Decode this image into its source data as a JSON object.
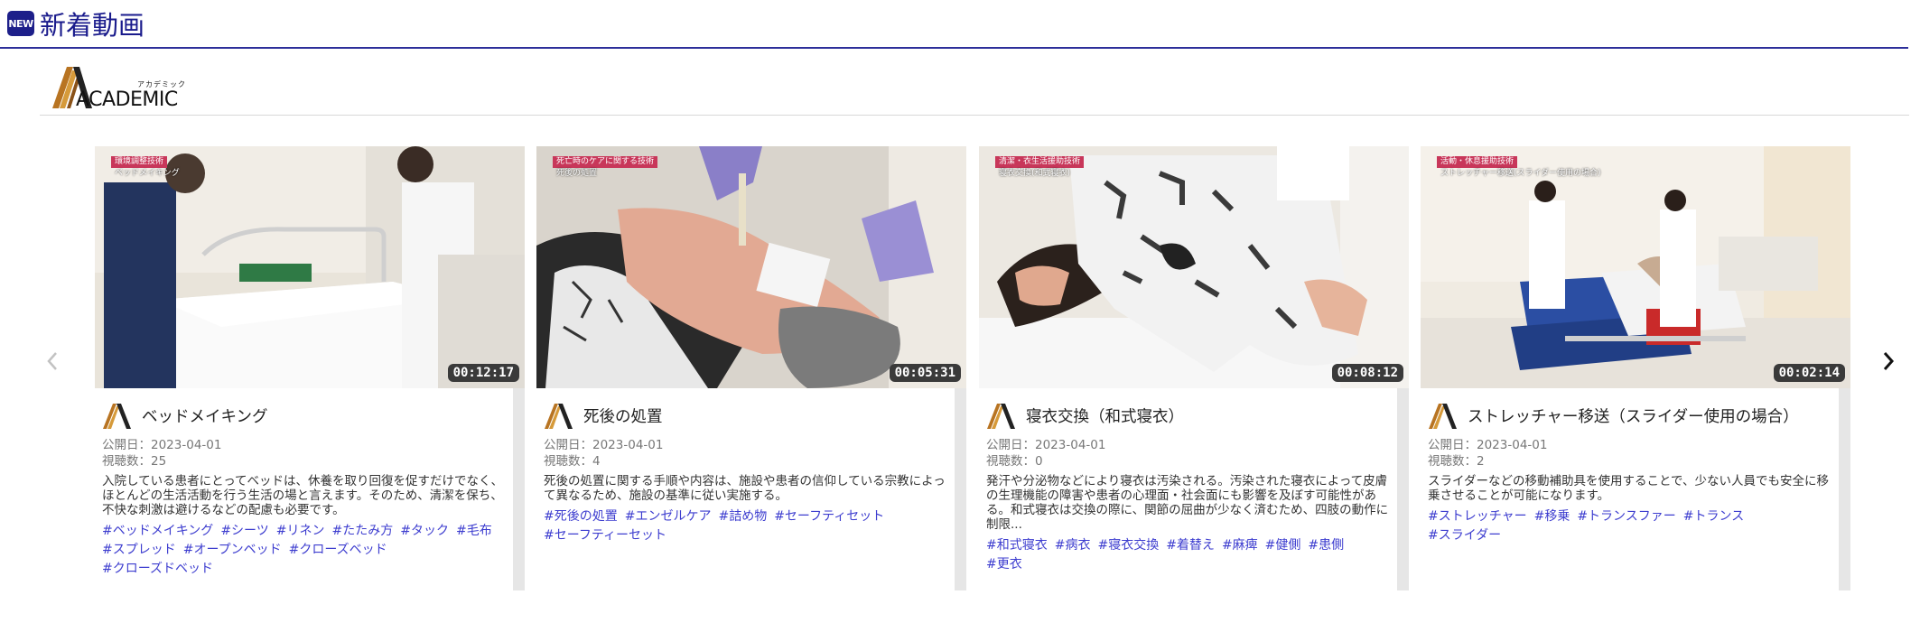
{
  "header": {
    "badge": "NEW",
    "title": "新着動画"
  },
  "brand": {
    "ruby": "アカデミック",
    "word": "ACADEMIC"
  },
  "carousel": {
    "prev_icon": "chevron-left-icon",
    "next_icon": "chevron-right-icon"
  },
  "labels": {
    "published": "公開日：",
    "views": "視聴数："
  },
  "cards": [
    {
      "category": "環境調整技術",
      "subcategory": "ベッドメイキング",
      "duration": "00:12:17",
      "title": "ベッドメイキング",
      "date": "2023-04-01",
      "views": "25",
      "description": "入院している患者にとってベッドは、休養を取り回復を促すだけでなく、ほとんどの生活活動を行う生活の場と言えます。そのため、清潔を保ち、不快な刺激は避けるなどの配慮も必要です。",
      "tags": [
        "#ベッドメイキング",
        "#シーツ",
        "#リネン",
        "#たたみ方",
        "#タック",
        "#毛布",
        "#スプレッド",
        "#オープンベッド",
        "#クローズベッド",
        "#クローズドベッド"
      ]
    },
    {
      "category": "死亡時のケアに関する技術",
      "subcategory": "死後の処置",
      "duration": "00:05:31",
      "title": "死後の処置",
      "date": "2023-04-01",
      "views": "4",
      "description": "死後の処置に関する手順や内容は、施設や患者の信仰している宗教によって異なるため、施設の基準に従い実施する。",
      "tags": [
        "#死後の処置",
        "#エンゼルケア",
        "#詰め物",
        "#セーフティセット",
        "#セーフティーセット"
      ]
    },
    {
      "category": "清潔・衣生活援助技術",
      "subcategory": "寝衣交換(和式寝衣)",
      "duration": "00:08:12",
      "title": "寝衣交換（和式寝衣）",
      "date": "2023-04-01",
      "views": "0",
      "description": "発汗や分泌物などにより寝衣は汚染される。汚染された寝衣によって皮膚の生理機能の障害や患者の心理面・社会面にも影響を及ぼす可能性がある。和式寝衣は交換の際に、関節の屈曲が少なく済むため、四肢の動作に制限...",
      "tags": [
        "#和式寝衣",
        "#病衣",
        "#寝衣交換",
        "#着替え",
        "#麻痺",
        "#健側",
        "#患側",
        "#更衣"
      ]
    },
    {
      "category": "活動・休息援助技術",
      "subcategory": "ストレッチャー移送(スライダー使用の場合)",
      "duration": "00:02:14",
      "title": "ストレッチャー移送（スライダー使用の場合）",
      "date": "2023-04-01",
      "views": "2",
      "description": "スライダーなどの移動補助具を使用することで、少ない人員でも安全に移乗させることが可能になります。",
      "tags": [
        "#ストレッチャー",
        "#移乗",
        "#トランスファー",
        "#トランス",
        "#スライダー"
      ]
    }
  ]
}
